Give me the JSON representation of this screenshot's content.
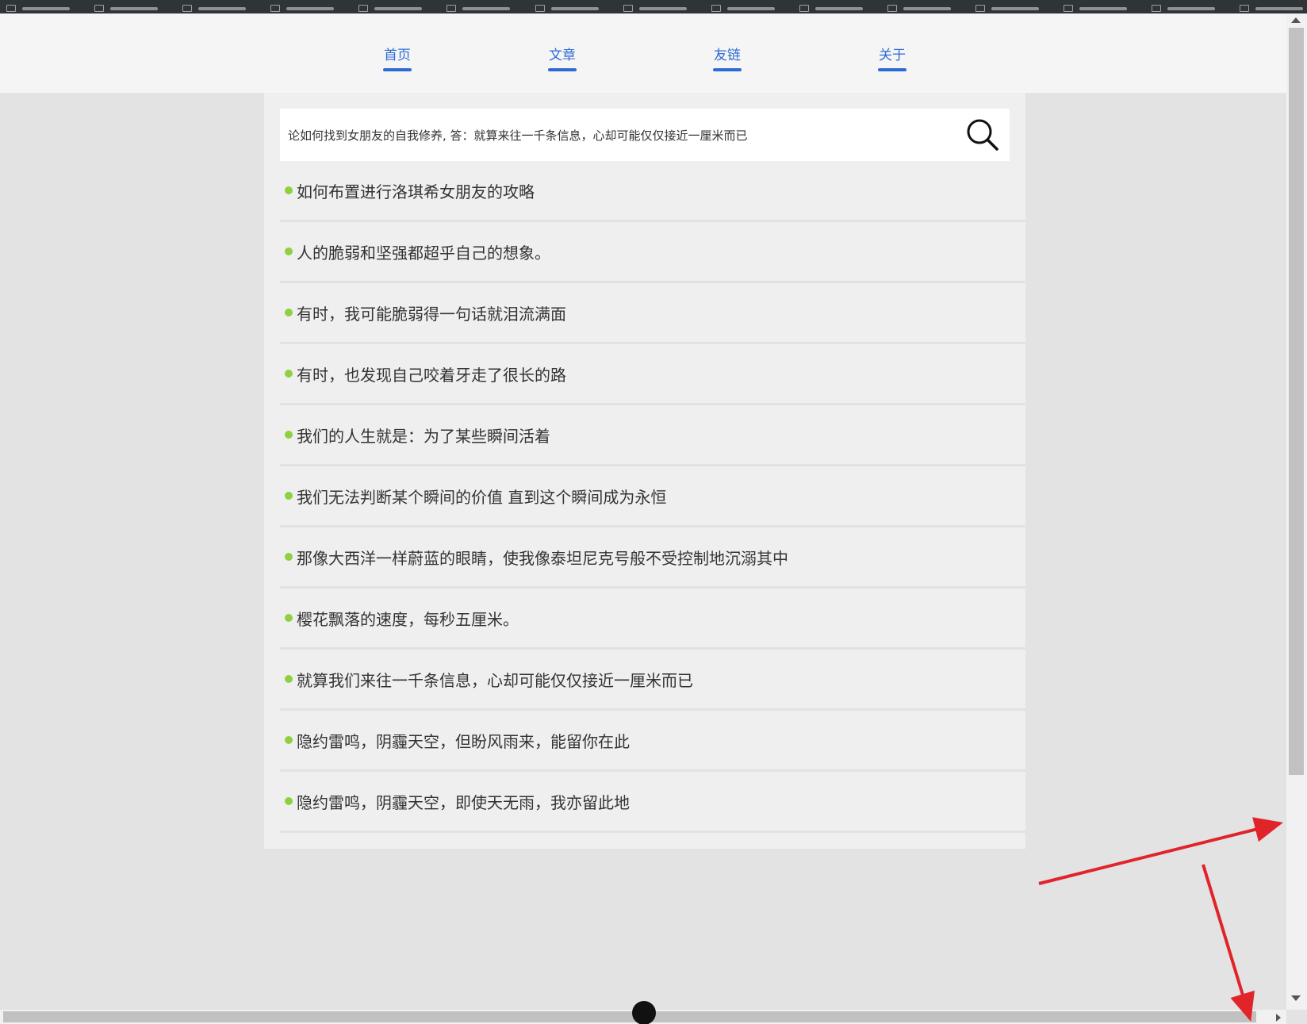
{
  "colors": {
    "accent": "#2e6bd6",
    "bullet": "#8dd13f",
    "annotation_arrow": "#e0242a",
    "page_background": "#e3e3e3",
    "panel_background": "#efefef"
  },
  "nav": {
    "items": [
      {
        "label": "首页"
      },
      {
        "label": "文章"
      },
      {
        "label": "友链"
      },
      {
        "label": "关于"
      }
    ]
  },
  "search": {
    "value": "论如何找到女朋友的自我修养, 答：就算来往一千条信息，心却可能仅仅接近一厘米而已",
    "icon": "search-icon"
  },
  "list": {
    "items": [
      {
        "text": "如何布置进行洛琪希女朋友的攻略"
      },
      {
        "text": "人的脆弱和坚强都超乎自己的想象。"
      },
      {
        "text": "有时，我可能脆弱得一句话就泪流满面"
      },
      {
        "text": "有时，也发现自己咬着牙走了很长的路"
      },
      {
        "text": "我们的人生就是：为了某些瞬间活着"
      },
      {
        "text": "我们无法判断某个瞬间的价值 直到这个瞬间成为永恒"
      },
      {
        "text": "那像大西洋一样蔚蓝的眼睛，使我像泰坦尼克号般不受控制地沉溺其中"
      },
      {
        "text": "樱花飘落的速度，每秒五厘米。"
      },
      {
        "text": "就算我们来往一千条信息，心却可能仅仅接近一厘米而已"
      },
      {
        "text": "隐约雷鸣，阴霾天空，但盼风雨来，能留你在此"
      },
      {
        "text": "隐约雷鸣，阴霾天空，即使天无雨，我亦留此地"
      }
    ]
  }
}
